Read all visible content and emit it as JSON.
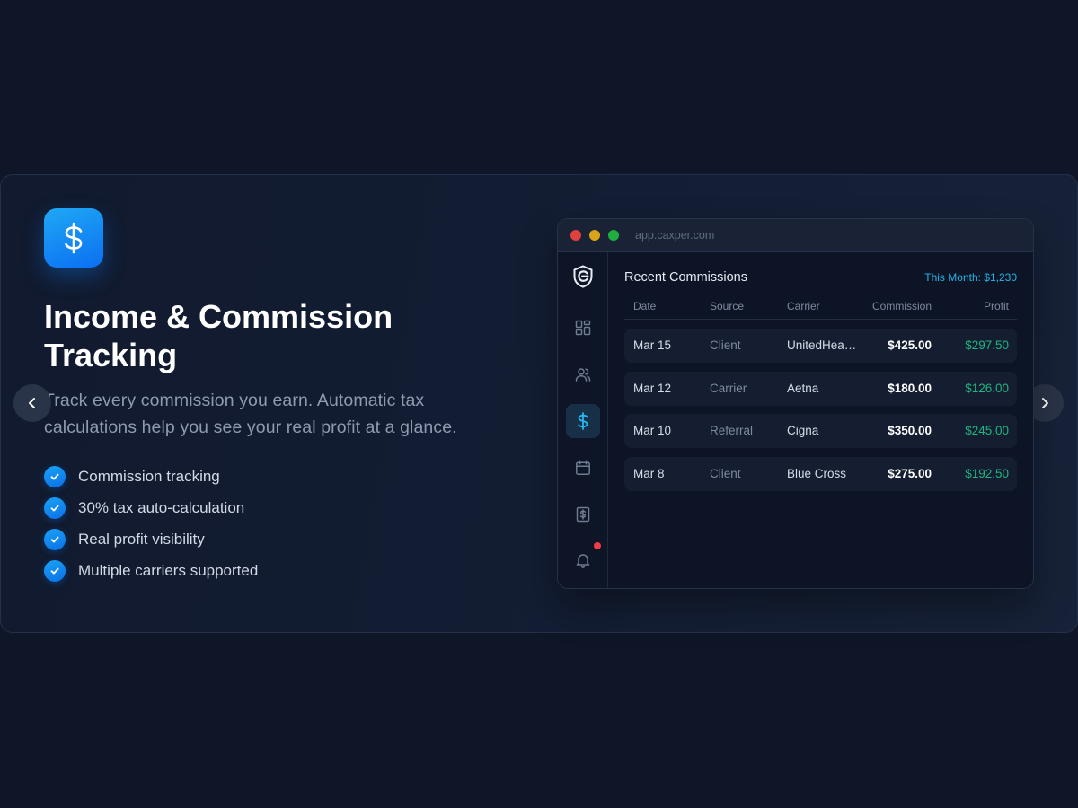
{
  "feature": {
    "icon": "dollar-icon",
    "title": "Income & Commission Tracking",
    "description": "Track every commission you earn. Automatic tax calculations help you see your real profit at a glance.",
    "bullets": [
      "Commission tracking",
      "30% tax auto-calculation",
      "Real profit visibility",
      "Multiple carriers supported"
    ]
  },
  "carousel": {
    "prev_icon": "chevron-left-icon",
    "next_icon": "chevron-right-icon"
  },
  "browser": {
    "url": "app.caxper.com",
    "dots": [
      "#e0413e",
      "#d9a31a",
      "#1fae3f"
    ]
  },
  "app": {
    "sidebar": [
      "logo-icon",
      "dashboard-icon",
      "users-icon",
      "dollar-icon",
      "calendar-icon",
      "receipt-icon",
      "bell-icon"
    ],
    "active_item": "dollar-icon",
    "section_title": "Recent Commissions",
    "month_summary": "This Month: $1,230",
    "table": {
      "headers": [
        "Date",
        "Source",
        "Carrier",
        "Commission",
        "Profit"
      ],
      "rows": [
        [
          "Mar 15",
          "Client",
          "UnitedHealthcare",
          "$425.00",
          "$297.50"
        ],
        [
          "Mar 12",
          "Carrier",
          "Aetna",
          "$180.00",
          "$126.00"
        ],
        [
          "Mar 10",
          "Referral",
          "Cigna",
          "$350.00",
          "$245.00"
        ],
        [
          "Mar 8",
          "Client",
          "Blue Cross",
          "$275.00",
          "$192.50"
        ]
      ]
    }
  },
  "colors": {
    "accent": "#0b7ff2",
    "profit": "#1fb57f",
    "month_summary": "#22b5e8",
    "notification": "#ef3c47"
  }
}
